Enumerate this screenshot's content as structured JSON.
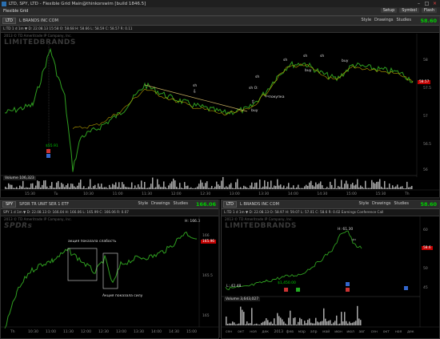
{
  "window": {
    "title": "LTD, SPY, LTD  -  Flexible Grid Main@thinkorswim [build 1846.5]",
    "minimize": "–",
    "maximize": "□",
    "close": "×"
  },
  "menu": {
    "item": "Flexible Grid"
  },
  "toolbar_right": {
    "setup": "Setup",
    "symbol": "Symbol",
    "flash": "Flash"
  },
  "top": {
    "symbol": "LTD",
    "name": "L BRANDS INC COM",
    "mini": "▲",
    "style": "Style",
    "drawings": "Drawings",
    "studies": "Studies",
    "price": "58.60",
    "quote": "L:TD 1 d 1m  ▼  D: 22.08.13 15:58  O: 58.68  H: 58.66  L: 58.59  C: 58.57  R: 0.11",
    "copyright": "2013 © TD Ameritrade IP Company, Inc.",
    "watermark": "LIMITEDBRANDS",
    "tag": "58.57",
    "yticks": [
      "58",
      "57.5",
      "57",
      "56.5",
      "56"
    ],
    "xticks": [
      "15:30",
      "Tu",
      "10:30",
      "11:00",
      "11:30",
      "12:00",
      "12:30",
      "13:00",
      "13:30",
      "14:00",
      "14:30",
      "15:00",
      "15:30",
      "Th"
    ],
    "volume_label": "Volume",
    "volume_value": "106,323",
    "low_label": "$55.91",
    "annotations": {
      "sh1": "sh",
      "buy1": "buy",
      "sh2": "sh",
      "sh3": "sh O:",
      "sh4": "sh",
      "sh5": "sh",
      "sh6": "sh",
      "pokupka": "покупка",
      "buy2": "buy",
      "buy3": "buy"
    }
  },
  "bottom_left": {
    "symbol": "SPY",
    "name": "SPDR TR UNIT SER 1 ETF",
    "style": "Style",
    "drawings": "Drawings",
    "studies": "Studies",
    "price": "166.06",
    "quote": "SPY 1 d 1m  ▼  D: 22.08.13  O: 166.04  H: 166.06  L: 165.99  C: 166.06  R: 0.07",
    "copyright": "2013 © TD Ameritrade IP Company, Inc.",
    "watermark": "SPDRs",
    "hi_label": "H: 166.3",
    "tag": "165.96",
    "yticks": [
      "166",
      "165.5",
      "165"
    ],
    "xticks": [
      "Th",
      "10:30",
      "11:00",
      "11:30",
      "12:00",
      "12:30",
      "13:00",
      "13:30",
      "14:00",
      "14:30",
      "15:00"
    ],
    "ann_weak": "акция показала слабость",
    "ann_strong": "Акция показала силу"
  },
  "bottom_right": {
    "symbol": "LTD",
    "name": "L BRANDS INC COM",
    "style": "Style",
    "drawings": "Drawings",
    "studies": "Studies",
    "price": "58.60",
    "quote": "L:TD 1 d 1m  ▼  D: 22.08.13  O: 58.97  H: 59.07  L: 57.01  C: 58.6  R: 0.02  Earnings Conference Call",
    "copyright": "2013 © TD Ameritrade IP Company, Inc.",
    "watermark": "LIMITEDBRANDS",
    "hi_label": "H: 61.30",
    "low1": "L: 42.48",
    "low2": "$1,450.00",
    "tag": "58.6",
    "yticks": [
      "60",
      "55",
      "50",
      "45"
    ],
    "xticks": [
      "сен",
      "окт",
      "ноя",
      "дек",
      "2013",
      "фев",
      "мар",
      "апр",
      "май",
      "июн",
      "июл",
      "авг",
      "сен",
      "окт",
      "ноя",
      "дек"
    ],
    "volume_label": "Volume",
    "volume_value": "3,643,027"
  }
}
